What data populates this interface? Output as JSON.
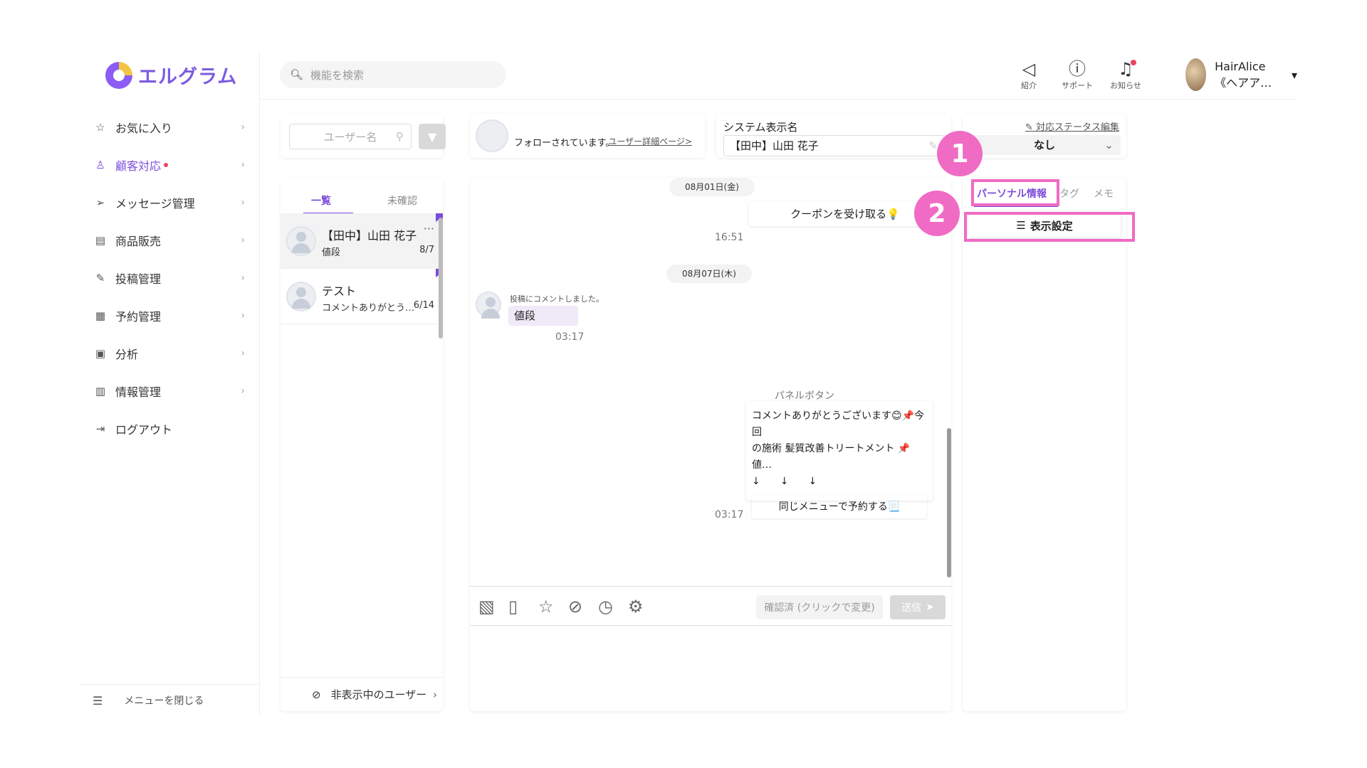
{
  "brand": {
    "name": "エルグラム"
  },
  "sidebar": {
    "items": [
      {
        "icon": "star-icon",
        "label": "お気に入り"
      },
      {
        "icon": "user-icon",
        "label": "顧客対応"
      },
      {
        "icon": "send-icon",
        "label": "メッセージ管理"
      },
      {
        "icon": "shop-icon",
        "label": "商品販売"
      },
      {
        "icon": "edit-icon",
        "label": "投稿管理"
      },
      {
        "icon": "calendar-icon",
        "label": "予約管理"
      },
      {
        "icon": "report-icon",
        "label": "分析"
      },
      {
        "icon": "chart-icon",
        "label": "情報管理"
      },
      {
        "icon": "logout-icon",
        "label": "ログアウト"
      }
    ],
    "close_menu": "メニューを閉じる"
  },
  "header": {
    "search_placeholder": "機能を検索",
    "icons": [
      {
        "icon": "megaphone-icon",
        "label": "紹介"
      },
      {
        "icon": "help-icon",
        "label": "サポート"
      },
      {
        "icon": "bell-icon",
        "label": "お知らせ"
      }
    ],
    "user_name": "HairAlice《ヘアア…"
  },
  "user_list": {
    "search_placeholder": "ユーザー名",
    "tabs": [
      "一覧",
      "未確認"
    ],
    "items": [
      {
        "name": "【田中】山田 花子",
        "preview": "値段",
        "date": "8/7",
        "more": "···"
      },
      {
        "name": "テスト",
        "preview": "コメントありがとう…",
        "date": "6/14"
      }
    ],
    "hidden_users": "非表示中のユーザー"
  },
  "follow": {
    "status": "フォローされています。",
    "link": "ユーザー詳細ページ>"
  },
  "system_name": {
    "label": "システム表示名",
    "value": "【田中】山田 花子"
  },
  "chat": {
    "date1": "08月01日(金)",
    "coupon": "クーポンを受け取る💡",
    "time1": "16:51",
    "date2": "08月07日(木)",
    "comment_note": "投稿にコメントしました。",
    "comment_text": "値段",
    "time2": "03:17",
    "panel_label": "パネルボタン",
    "panel_text_1": "コメントありがとうございます😊📌今回",
    "panel_text_2": "の施術 髪質改善トリートメント 📌値…",
    "panel_arrows": "↓　　↓　　↓",
    "panel_button": "同じメニューで予約する📃",
    "time3": "03:17",
    "confirm_label": "確認済 (クリックで変更)",
    "send_label": "送信"
  },
  "status": {
    "edit_label": "対応ステータス編集",
    "value": "なし"
  },
  "right_panel": {
    "tabs": [
      "パーソナル情報",
      "タグ",
      "メモ"
    ],
    "display_settings": "表示設定"
  },
  "annotations": {
    "one": "1",
    "two": "2"
  },
  "colors": {
    "accent": "#7c4ddc",
    "highlight": "#f06bc4",
    "alert": "#e94560"
  }
}
